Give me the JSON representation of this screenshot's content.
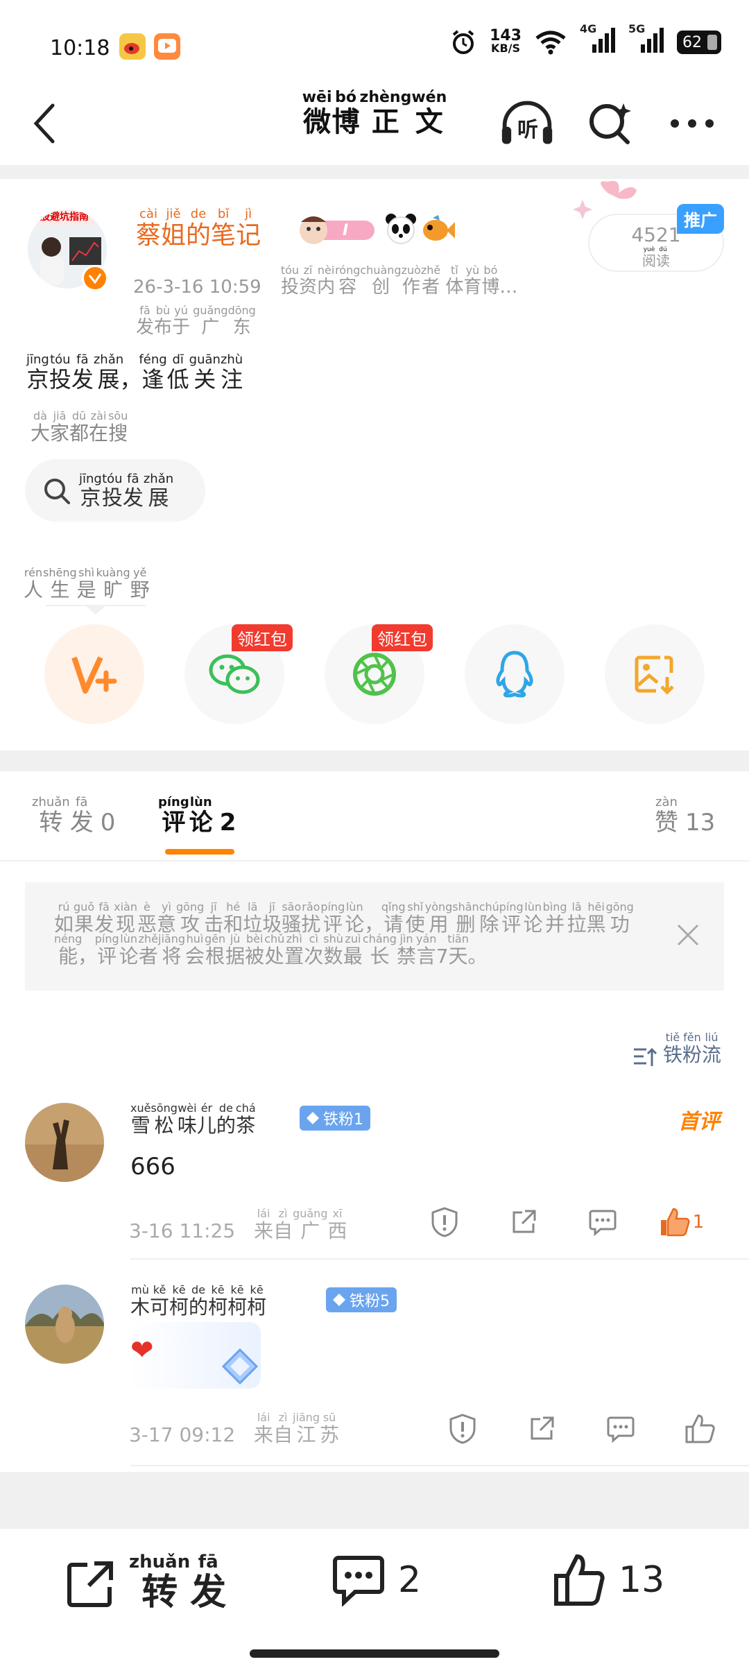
{
  "status_bar": {
    "time": "10:18",
    "net_speed": "143",
    "net_unit": "KB/S",
    "net_4g": "4G",
    "net_5g": "5G",
    "battery": "62",
    "icons": [
      "weibo-app-icon",
      "video-app-icon",
      "alarm-icon",
      "wifi-icon",
      "signal-4g-icon",
      "signal-5g-icon",
      "battery-icon"
    ]
  },
  "header": {
    "title": [
      {
        "c": "微",
        "p": "wēi"
      },
      {
        "c": "博",
        "p": "bó"
      },
      {
        "c": "正",
        "p": "zhèng"
      },
      {
        "c": "文",
        "p": "wén"
      }
    ],
    "listen_label": "听"
  },
  "post": {
    "author": [
      {
        "c": "蔡",
        "p": "cài"
      },
      {
        "c": "姐",
        "p": "jiě"
      },
      {
        "c": "的",
        "p": "de"
      },
      {
        "c": "笔",
        "p": "bǐ"
      },
      {
        "c": "记",
        "p": "jì"
      }
    ],
    "avatar_banner": "炒股避坑指南",
    "timestamp": "26-3-16 10:59",
    "creator_tag": [
      {
        "c": "投",
        "p": "tóu"
      },
      {
        "c": "资",
        "p": "zī"
      },
      {
        "c": "内",
        "p": "nèi"
      },
      {
        "c": "容",
        "p": "róng"
      },
      {
        "c": "创",
        "p": "chuàng"
      },
      {
        "c": "作",
        "p": "zuò"
      },
      {
        "c": "者",
        "p": "zhě"
      },
      {
        "c": " ",
        "p": ""
      },
      {
        "c": "体",
        "p": "tǐ"
      },
      {
        "c": "育",
        "p": "yù"
      },
      {
        "c": "博",
        "p": "bó"
      },
      {
        "c": "…",
        "p": ""
      }
    ],
    "location": [
      {
        "c": "发",
        "p": "fā"
      },
      {
        "c": "布",
        "p": "bù"
      },
      {
        "c": "于",
        "p": "yú"
      },
      {
        "c": " ",
        "p": ""
      },
      {
        "c": "广",
        "p": "guǎng"
      },
      {
        "c": "东",
        "p": "dōng"
      }
    ],
    "reads_count": "4521",
    "reads_label": [
      {
        "c": "阅",
        "p": "yuè"
      },
      {
        "c": "读",
        "p": "dú"
      }
    ],
    "promo_label": "推广",
    "level_badge": "I",
    "text": [
      {
        "c": "京",
        "p": "jīng"
      },
      {
        "c": "投",
        "p": "tóu"
      },
      {
        "c": "发",
        "p": "fā"
      },
      {
        "c": "展",
        "p": "zhǎn"
      },
      {
        "c": "，",
        "p": ""
      },
      {
        "c": "逢",
        "p": "féng"
      },
      {
        "c": "低",
        "p": "dī"
      },
      {
        "c": "关",
        "p": "guān"
      },
      {
        "c": "注",
        "p": "zhù"
      }
    ],
    "search_hint": [
      {
        "c": "大",
        "p": "dà"
      },
      {
        "c": "家",
        "p": "jiā"
      },
      {
        "c": "都",
        "p": "dū"
      },
      {
        "c": "在",
        "p": "zài"
      },
      {
        "c": "搜",
        "p": "sōu"
      }
    ],
    "topic": [
      {
        "c": "京",
        "p": "jīng"
      },
      {
        "c": "投",
        "p": "tóu"
      },
      {
        "c": "发",
        "p": "fā"
      },
      {
        "c": "展",
        "p": "zhǎn"
      }
    ],
    "signature": [
      {
        "c": "人",
        "p": "rén"
      },
      {
        "c": "生",
        "p": "shēng"
      },
      {
        "c": "是",
        "p": "shì"
      },
      {
        "c": "旷",
        "p": "kuàng"
      },
      {
        "c": "野",
        "p": "yě"
      }
    ],
    "redpack_label": "领红包",
    "share_targets": [
      "vplus-icon",
      "wechat-icon",
      "moments-icon",
      "qq-icon",
      "save-image-icon"
    ]
  },
  "tabs": {
    "repost": {
      "label": [
        {
          "c": "转",
          "p": "zhuǎn"
        },
        {
          "c": "发",
          "p": "fā"
        }
      ],
      "count": "0"
    },
    "comments": {
      "label": [
        {
          "c": "评",
          "p": "píng"
        },
        {
          "c": "论",
          "p": "lùn"
        }
      ],
      "count": "2"
    },
    "likes": {
      "label": [
        {
          "c": "赞",
          "p": "zàn"
        }
      ],
      "count": "13"
    }
  },
  "notice": {
    "text": [
      {
        "c": "如",
        "p": "rú"
      },
      {
        "c": "果",
        "p": "guǒ"
      },
      {
        "c": "发",
        "p": "fā"
      },
      {
        "c": "现",
        "p": "xiàn"
      },
      {
        "c": "恶",
        "p": "è"
      },
      {
        "c": "意",
        "p": "yì"
      },
      {
        "c": "攻",
        "p": "gōng"
      },
      {
        "c": "击",
        "p": "jī"
      },
      {
        "c": "和",
        "p": "hé"
      },
      {
        "c": "垃",
        "p": "lā"
      },
      {
        "c": "圾",
        "p": "jī"
      },
      {
        "c": "骚",
        "p": "sāo"
      },
      {
        "c": "扰",
        "p": "rǎo"
      },
      {
        "c": "评",
        "p": "píng"
      },
      {
        "c": "论",
        "p": "lùn"
      },
      {
        "c": "，",
        "p": ""
      },
      {
        "c": "请",
        "p": "qǐng"
      },
      {
        "c": "使",
        "p": "shǐ"
      },
      {
        "c": "用",
        "p": "yòng"
      },
      {
        "c": "删",
        "p": "shān"
      },
      {
        "c": "除",
        "p": "chú"
      },
      {
        "c": "评",
        "p": "píng"
      },
      {
        "c": "论",
        "p": "lùn"
      },
      {
        "c": "并",
        "p": "bìng"
      },
      {
        "c": "拉",
        "p": "lā"
      },
      {
        "c": "黑",
        "p": "hēi"
      },
      {
        "c": "功",
        "p": "gōng"
      },
      {
        "c": "能",
        "p": "néng"
      },
      {
        "c": "，",
        "p": ""
      },
      {
        "c": "评",
        "p": "píng"
      },
      {
        "c": "论",
        "p": "lùn"
      },
      {
        "c": "者",
        "p": "zhě"
      },
      {
        "c": "将",
        "p": "jiāng"
      },
      {
        "c": "会",
        "p": "huì"
      },
      {
        "c": "根",
        "p": "gēn"
      },
      {
        "c": "据",
        "p": "jù"
      },
      {
        "c": "被",
        "p": "bèi"
      },
      {
        "c": "处",
        "p": "chǔ"
      },
      {
        "c": "置",
        "p": "zhì"
      },
      {
        "c": "次",
        "p": "cì"
      },
      {
        "c": "数",
        "p": "shù"
      },
      {
        "c": "最",
        "p": "zuì"
      },
      {
        "c": "长",
        "p": "cháng"
      },
      {
        "c": "禁",
        "p": "jìn"
      },
      {
        "c": "言",
        "p": "yán"
      },
      {
        "c": "7",
        "p": ""
      },
      {
        "c": "天",
        "p": "tiān"
      },
      {
        "c": "。",
        "p": ""
      }
    ]
  },
  "sort": {
    "label": [
      {
        "c": "铁",
        "p": "tiě"
      },
      {
        "c": "粉",
        "p": "fěn"
      },
      {
        "c": "流",
        "p": "liú"
      }
    ]
  },
  "comments": [
    {
      "name": [
        {
          "c": "雪",
          "p": "xuě"
        },
        {
          "c": "松",
          "p": "sōng"
        },
        {
          "c": "味",
          "p": "wèi"
        },
        {
          "c": "儿",
          "p": "ér"
        },
        {
          "c": "的",
          "p": "de"
        },
        {
          "c": "茶",
          "p": "chá"
        }
      ],
      "badge": "铁粉1",
      "text": "666",
      "time": "3-16 11:25",
      "from": [
        {
          "c": "来",
          "p": "lái"
        },
        {
          "c": "自",
          "p": "zì"
        },
        {
          "c": "广",
          "p": "guǎng"
        },
        {
          "c": "西",
          "p": "xī"
        }
      ],
      "likes": "1",
      "tag": "首评"
    },
    {
      "name": [
        {
          "c": "木",
          "p": "mù"
        },
        {
          "c": "可",
          "p": "kě"
        },
        {
          "c": "柯",
          "p": "kē"
        },
        {
          "c": "的",
          "p": "de"
        },
        {
          "c": "柯",
          "p": "kē"
        },
        {
          "c": "柯",
          "p": "kē"
        },
        {
          "c": "柯",
          "p": "kē"
        }
      ],
      "badge": "铁粉5",
      "text": "❤",
      "time": "3-17 09:12",
      "from": [
        {
          "c": "来",
          "p": "lái"
        },
        {
          "c": "自",
          "p": "zì"
        },
        {
          "c": "江",
          "p": "jiāng"
        },
        {
          "c": "苏",
          "p": "sū"
        }
      ]
    }
  ],
  "bottom_bar": {
    "repost": [
      {
        "c": "转",
        "p": "zhuǎn"
      },
      {
        "c": "发",
        "p": "fā"
      }
    ],
    "comments_count": "2",
    "likes_count": "13"
  },
  "colors": {
    "accent": "#ff8200",
    "author": "#e86a1f",
    "redpack": "#f13b2f",
    "fan_badge": "#6aa4ee"
  }
}
